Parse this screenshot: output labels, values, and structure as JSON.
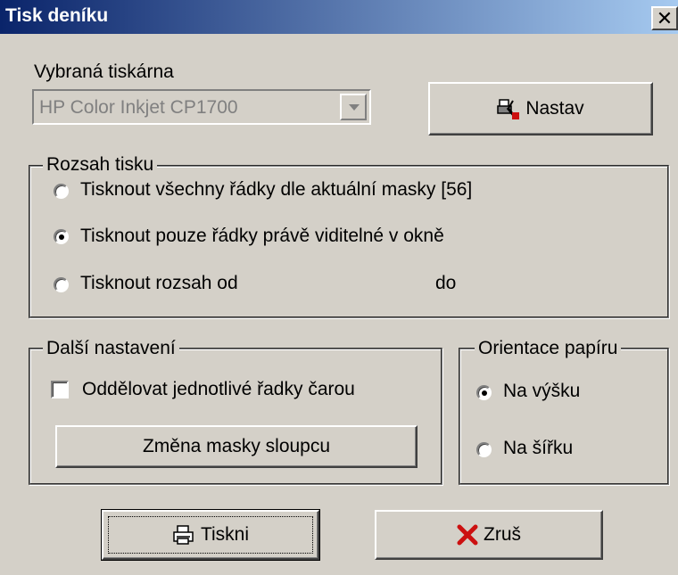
{
  "window": {
    "title": "Tisk deníku",
    "close_glyph": "✕"
  },
  "printer": {
    "label": "Vybraná tiskárna",
    "selected": "HP Color Inkjet CP1700",
    "setup_button": "Nastav",
    "setup_icon": "printer-setup-icon"
  },
  "range": {
    "legend": "Rozsah tisku",
    "options": [
      {
        "label": "Tisknout všechny řádky dle aktuální masky [56]",
        "selected": false
      },
      {
        "label": "Tisknout pouze řádky právě viditelné v okně",
        "selected": true
      },
      {
        "label": "Tisknout rozsah od",
        "selected": false
      }
    ],
    "to_label": "do"
  },
  "other": {
    "legend": "Další nastavení",
    "separator_checkbox": "Oddělovat jednotlivé řadky čarou",
    "separator_checked": false,
    "mask_button": "Změna masky sloupcu"
  },
  "orientation": {
    "legend": "Orientace papíru",
    "options": [
      {
        "label": "Na výšku",
        "selected": true
      },
      {
        "label": "Na šířku",
        "selected": false
      }
    ]
  },
  "actions": {
    "print_button": "Tiskni",
    "print_icon": "printer-icon",
    "cancel_button": "Zruš",
    "cancel_icon": "red-x-icon"
  },
  "colors": {
    "titlebar": "#0a246a",
    "face": "#d4d0c8",
    "cancel_x": "#cc1010"
  }
}
